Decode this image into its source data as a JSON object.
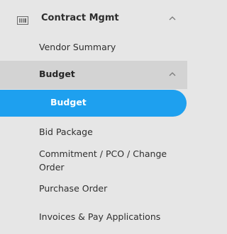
{
  "sidebar": {
    "section": {
      "title": "Contract Mgmt",
      "icon": "ledger-icon"
    },
    "items": [
      {
        "label": "Vendor Summary"
      },
      {
        "label": "Budget"
      },
      {
        "label": "Budget"
      },
      {
        "label": "Bid Package"
      },
      {
        "label": "Commitment / PCO / Change Order"
      },
      {
        "label": "Purchase Order"
      },
      {
        "label": "Invoices & Pay Applications"
      }
    ],
    "colors": {
      "active": "#1ea0ef",
      "group_bg": "#d3d3d3",
      "background": "#e6e6e6"
    }
  }
}
